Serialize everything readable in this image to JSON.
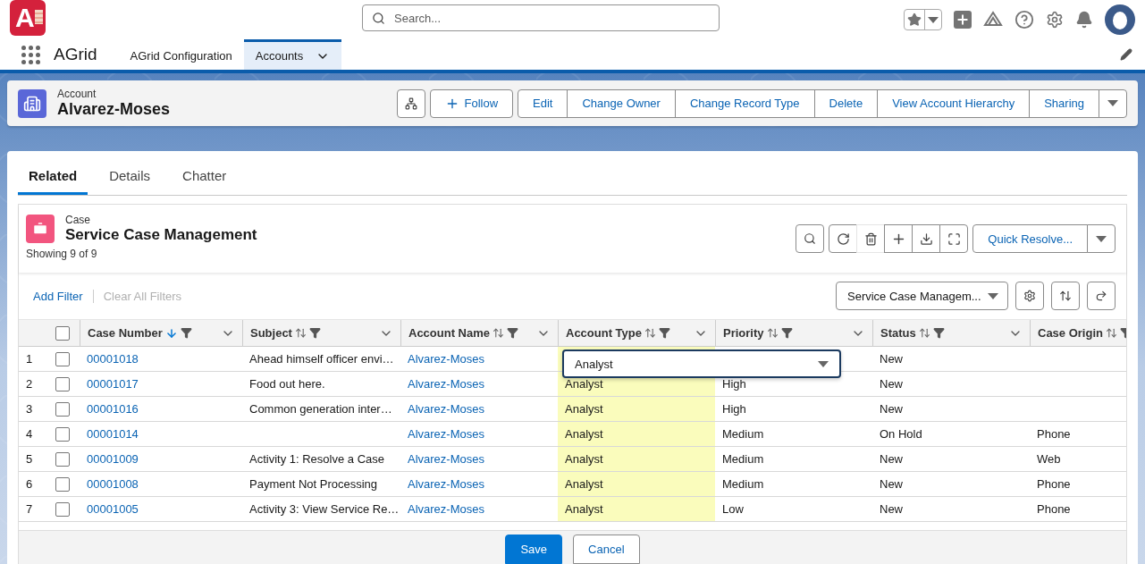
{
  "header": {
    "logo_letter": "A",
    "search": {
      "placeholder": "Search..."
    }
  },
  "nav": {
    "app_name": "AGrid",
    "tabs": [
      {
        "label": "AGrid Configuration",
        "selected": false,
        "menu": false
      },
      {
        "label": "Accounts",
        "selected": true,
        "menu": true
      }
    ]
  },
  "record": {
    "object": "Account",
    "name": "Alvarez-Moses",
    "actions": [
      {
        "label": "Follow",
        "kind": "add"
      },
      {
        "label": "Edit",
        "kind": "text"
      },
      {
        "label": "Change Owner",
        "kind": "text"
      },
      {
        "label": "Change Record Type",
        "kind": "text"
      },
      {
        "label": "Delete",
        "kind": "text"
      },
      {
        "label": "View Account Hierarchy",
        "kind": "text"
      },
      {
        "label": "Sharing",
        "kind": "text"
      }
    ]
  },
  "tabs": [
    {
      "label": "Related",
      "selected": true
    },
    {
      "label": "Details",
      "selected": false
    },
    {
      "label": "Chatter",
      "selected": false
    }
  ],
  "related_list": {
    "object": "Case",
    "title": "Service Case Management",
    "count": "Showing 9 of 9",
    "toolbar": [
      {
        "kind": "refresh",
        "disabled": false
      },
      {
        "kind": "delete",
        "disabled": true
      },
      {
        "kind": "add",
        "disabled": false
      },
      {
        "kind": "download",
        "disabled": false
      },
      {
        "kind": "expand",
        "disabled": false
      }
    ],
    "quick_action": "Quick Resolve...",
    "select_all": {
      "checked": false
    },
    "add_filter": "Add Filter",
    "clear_filters": {
      "label": "Clear All Filters",
      "disabled": true
    },
    "view": "Service Case Managem...",
    "columns": [
      {
        "label": "Case Number",
        "sorted": true,
        "kind": "link"
      },
      {
        "label": "Subject",
        "sorted": false,
        "kind": "text"
      },
      {
        "label": "Account Name",
        "sorted": false,
        "kind": "link"
      },
      {
        "label": "Account Type",
        "sorted": false,
        "kind": "edited"
      },
      {
        "label": "Priority",
        "sorted": false,
        "kind": "text"
      },
      {
        "label": "Status",
        "sorted": false,
        "kind": "text"
      },
      {
        "label": "Case Origin",
        "sorted": false,
        "kind": "text"
      }
    ],
    "rows": [
      {
        "number": "1",
        "checked": false,
        "cells": [
          "00001018",
          "Ahead himself officer envi…",
          "Alvarez-Moses",
          null,
          null,
          "New",
          null
        ]
      },
      {
        "number": "2",
        "checked": false,
        "cells": [
          "00001017",
          "Food out here.",
          "Alvarez-Moses",
          "Analyst",
          "High",
          "New",
          null
        ]
      },
      {
        "number": "3",
        "checked": false,
        "cells": [
          "00001016",
          "Common generation inter…",
          "Alvarez-Moses",
          "Analyst",
          "High",
          "New",
          null
        ]
      },
      {
        "number": "4",
        "checked": false,
        "cells": [
          "00001014",
          null,
          "Alvarez-Moses",
          "Analyst",
          "Medium",
          "On Hold",
          "Phone"
        ]
      },
      {
        "number": "5",
        "checked": false,
        "cells": [
          "00001009",
          "Activity 1: Resolve a Case",
          "Alvarez-Moses",
          "Analyst",
          "Medium",
          "New",
          "Web"
        ]
      },
      {
        "number": "6",
        "checked": false,
        "cells": [
          "00001008",
          "Payment Not Processing",
          "Alvarez-Moses",
          "Analyst",
          "Medium",
          "New",
          "Phone"
        ]
      },
      {
        "number": "7",
        "checked": false,
        "cells": [
          "00001005",
          "Activity 3: View Service Re…",
          "Alvarez-Moses",
          "Analyst",
          "Low",
          "New",
          "Phone"
        ]
      }
    ],
    "cell_editor": {
      "value": "Analyst"
    },
    "footer": {
      "buttons": [
        {
          "label": "Save",
          "kind": "brand"
        },
        {
          "label": "Cancel",
          "kind": "neutral"
        }
      ]
    }
  }
}
